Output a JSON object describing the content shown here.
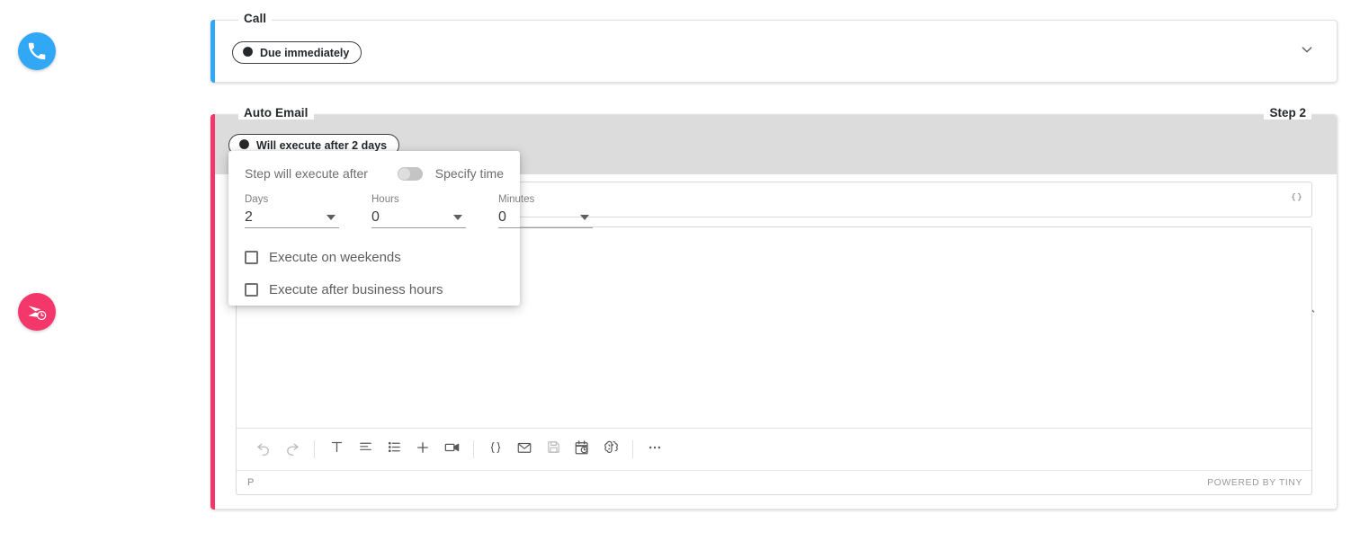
{
  "rail": {
    "items": [
      {
        "name": "call",
        "icon": "phone-icon",
        "color": "#31A8F5",
        "title": "Call"
      },
      {
        "name": "auto-email",
        "icon": "scheduled-send-icon",
        "color": "#F4376A",
        "title": "Auto Email"
      }
    ]
  },
  "call_step": {
    "legend": "Call",
    "chip_label": "Due immediately",
    "chip_icon": "clock-icon",
    "expand_icon": "chevron-down-icon",
    "accent_color": "#31A8F5"
  },
  "email_step": {
    "legend": "Auto Email",
    "step_number": "Step 2",
    "chip_label": "Will execute after 2 days",
    "chip_icon": "clock-icon",
    "accent_color": "#F4376A",
    "header_actions": [
      {
        "name": "duplicate-step-button",
        "icon": "copy-icon"
      },
      {
        "name": "move-step-down-button",
        "icon": "arrow-down-icon"
      },
      {
        "name": "move-step-up-button",
        "icon": "arrow-up-icon"
      },
      {
        "name": "delete-step-button",
        "icon": "close-x-icon"
      },
      {
        "name": "collapse-step-button",
        "icon": "chevron-up-icon"
      }
    ],
    "subject": {
      "value": "",
      "placeholder": "",
      "merge_icon": "curly-braces-icon"
    },
    "editor": {
      "content": "",
      "element_path": "P",
      "brand": "POWERED BY TINY",
      "toolbar": [
        {
          "name": "undo-button",
          "icon": "undo-icon",
          "disabled": true
        },
        {
          "name": "redo-button",
          "icon": "redo-icon",
          "disabled": true
        },
        {
          "name": "separator",
          "icon": "separator"
        },
        {
          "name": "formats-button",
          "icon": "text-format-icon"
        },
        {
          "name": "align-button",
          "icon": "align-left-icon"
        },
        {
          "name": "bullet-list-button",
          "icon": "bullet-list-icon"
        },
        {
          "name": "insert-button",
          "icon": "plus-icon"
        },
        {
          "name": "insert-video-button",
          "icon": "video-camera-icon"
        },
        {
          "name": "separator",
          "icon": "separator"
        },
        {
          "name": "merge-tags-button",
          "icon": "curly-braces-icon"
        },
        {
          "name": "email-template-button",
          "icon": "envelope-icon"
        },
        {
          "name": "save-template-button",
          "icon": "floppy-disk-icon"
        },
        {
          "name": "schedule-button",
          "icon": "calendar-clock-icon"
        },
        {
          "name": "ai-assist-button",
          "icon": "brain-icon"
        },
        {
          "name": "separator",
          "icon": "separator"
        },
        {
          "name": "more-options-button",
          "icon": "ellipsis-icon"
        }
      ]
    }
  },
  "delay_popover": {
    "title": "Step will execute after",
    "specify_time_label": "Specify time",
    "specify_time_on": false,
    "fields": [
      {
        "label": "Days",
        "value": "2",
        "name": "days-select"
      },
      {
        "label": "Hours",
        "value": "0",
        "name": "hours-select"
      },
      {
        "label": "Minutes",
        "value": "0",
        "name": "minutes-select"
      }
    ],
    "checkboxes": [
      {
        "label": "Execute on weekends",
        "checked": false,
        "name": "execute-on-weekends-checkbox"
      },
      {
        "label": "Execute after business hours",
        "checked": false,
        "name": "execute-after-business-hours-checkbox"
      }
    ]
  }
}
